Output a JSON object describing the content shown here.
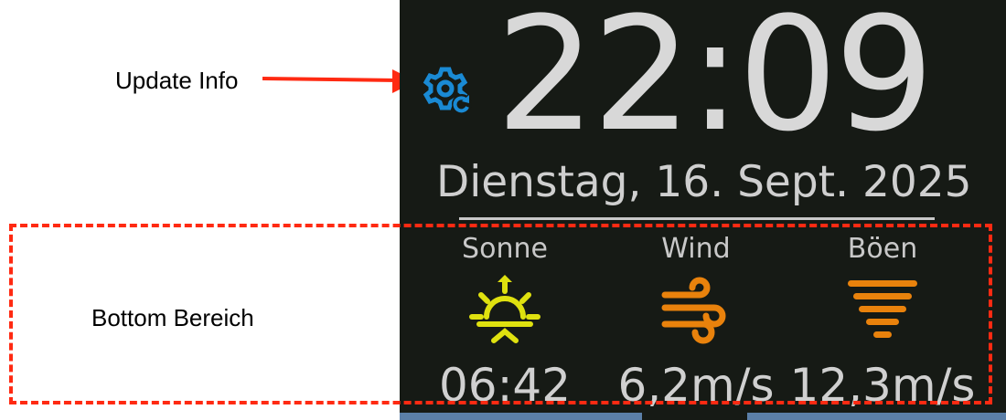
{
  "screen": {
    "time": "22:09",
    "date": "Dienstag, 16. Sept. 2025",
    "update_icon": "gear-refresh-icon",
    "columns": [
      {
        "label": "Sonne",
        "icon": "sunrise-icon",
        "value": "06:42",
        "color": "#dfe10f"
      },
      {
        "label": "Wind",
        "icon": "wind-icon",
        "value": "6,2m/s",
        "color": "#e9820c"
      },
      {
        "label": "Böen",
        "icon": "gust-icon",
        "value": "12,3m/s",
        "color": "#e9820c"
      }
    ],
    "accent": "#1a8ad4"
  },
  "annotations": {
    "update_info": "Update Info",
    "bottom_area": "Bottom Bereich",
    "color": "#ff2a12"
  }
}
